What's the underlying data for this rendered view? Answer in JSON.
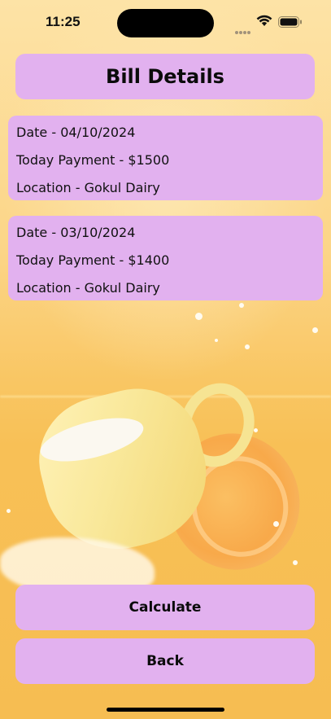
{
  "status_bar": {
    "time": "11:25",
    "icons": [
      "signal-icon",
      "wifi-icon",
      "battery-icon"
    ]
  },
  "header": {
    "title": "Bill Details"
  },
  "bills": [
    {
      "date": "Date - 04/10/2024",
      "payment": "Today Payment - $1500",
      "location": "Location - Gokul Dairy"
    },
    {
      "date": "Date - 03/10/2024",
      "payment": "Today Payment - $1400",
      "location": "Location - Gokul Dairy"
    }
  ],
  "actions": {
    "calculate_label": "Calculate",
    "back_label": "Back"
  },
  "colors": {
    "card": "#e2b1ef",
    "background": "#f6c864",
    "text": "#0b0b0b"
  }
}
